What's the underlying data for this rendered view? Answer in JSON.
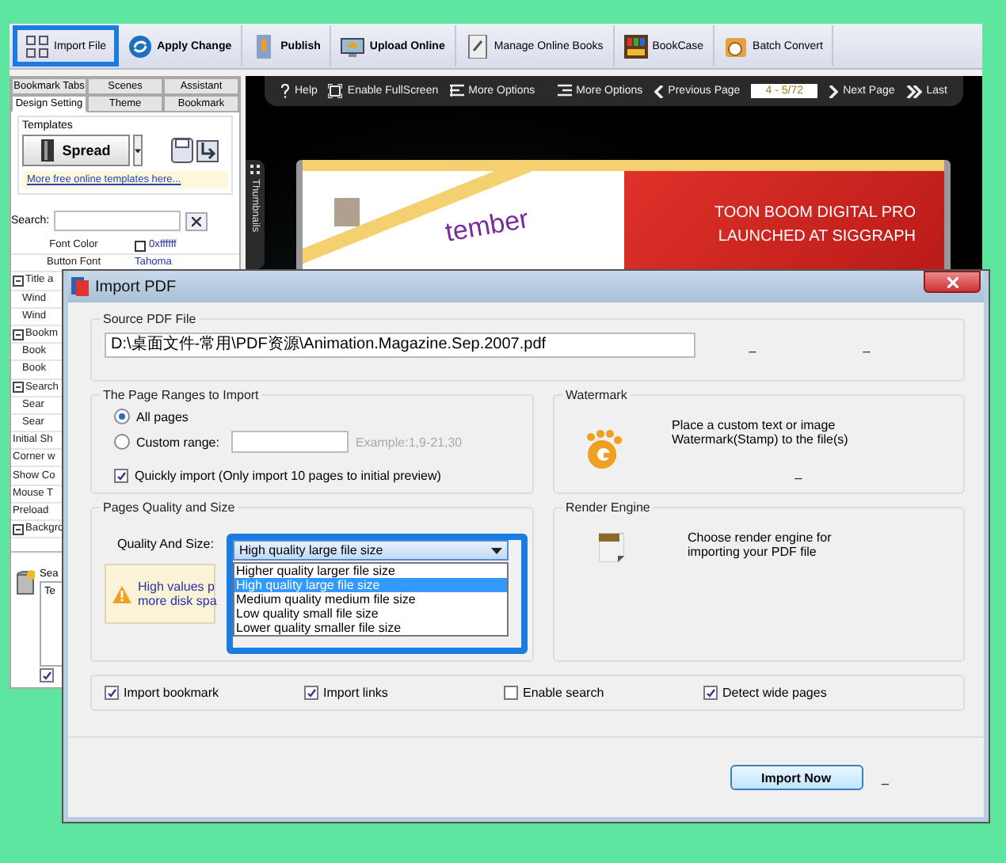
{
  "toolbar": {
    "buttons": [
      {
        "label": "Import File",
        "kind": "import",
        "highlighted": true,
        "bold": false
      },
      {
        "label": "Apply Change",
        "kind": "apply",
        "highlighted": false,
        "bold": true
      },
      {
        "label": "Publish",
        "kind": "publish",
        "highlighted": false,
        "bold": true
      },
      {
        "label": "Upload Online",
        "kind": "upload",
        "highlighted": false,
        "bold": true
      },
      {
        "label": "Manage Online Books",
        "kind": "manage",
        "highlighted": false,
        "bold": false
      },
      {
        "label": "BookCase",
        "kind": "bookcase",
        "highlighted": false,
        "bold": false
      },
      {
        "label": "Batch Convert",
        "kind": "batch",
        "highlighted": false,
        "bold": false
      }
    ]
  },
  "left_panel": {
    "tab_rows": [
      [
        {
          "label": "Bookmark Tabs",
          "selected": false
        },
        {
          "label": "Scenes",
          "selected": false
        },
        {
          "label": "Assistant",
          "selected": false
        }
      ],
      [
        {
          "label": "Design Setting",
          "selected": true
        },
        {
          "label": "Theme",
          "selected": false
        },
        {
          "label": "Bookmark",
          "selected": false
        }
      ]
    ],
    "templates": {
      "label": "Templates",
      "button": "Spread",
      "link": "More free online templates here..."
    },
    "search": {
      "label": "Search:"
    },
    "properties": [
      {
        "kind": "item",
        "label": "Font Color",
        "value": "0xffffff"
      },
      {
        "kind": "item",
        "label": "Button Font",
        "value": "Tahoma"
      },
      {
        "kind": "group",
        "label": "Title a",
        "expanded": true
      },
      {
        "kind": "sub",
        "label": "Wind"
      },
      {
        "kind": "sub",
        "label": "Wind"
      },
      {
        "kind": "group",
        "label": "Bookm",
        "expanded": true
      },
      {
        "kind": "sub",
        "label": "Book"
      },
      {
        "kind": "sub",
        "label": "Book"
      },
      {
        "kind": "group",
        "label": "Search",
        "expanded": true
      },
      {
        "kind": "sub",
        "label": "Sear"
      },
      {
        "kind": "sub",
        "label": "Sear"
      },
      {
        "kind": "item",
        "label": "Initial Sh"
      },
      {
        "kind": "item",
        "label": "Corner w"
      },
      {
        "kind": "item",
        "label": "Show Co"
      },
      {
        "kind": "item",
        "label": "Mouse T"
      },
      {
        "kind": "item",
        "label": "Preload"
      },
      {
        "kind": "group",
        "label": "Backgro",
        "expanded": true
      }
    ],
    "description": {
      "label": "Sea",
      "text": "Te",
      "checked": true
    }
  },
  "viewer": {
    "toolbar": [
      {
        "kind": "help",
        "label": "Help"
      },
      {
        "kind": "fullscreen",
        "label": "Enable FullScreen"
      },
      {
        "kind": "options",
        "label": "More Options"
      },
      {
        "kind": "spacer"
      },
      {
        "kind": "options-right",
        "label": "More Options"
      },
      {
        "kind": "prev",
        "label": "Previous Page"
      },
      {
        "kind": "page",
        "label": "4 - 5/72"
      },
      {
        "kind": "next",
        "label": "Next Page"
      },
      {
        "kind": "last",
        "label": "Last"
      }
    ],
    "side_tab": "Thumbnails",
    "book": {
      "month": "tember",
      "headline": [
        "TOON BOOM DIGITAL PRO",
        "LAUNCHED AT SIGGRAPH"
      ]
    }
  },
  "dialog": {
    "title": "Import PDF",
    "source": {
      "title": "Source PDF File",
      "value": "D:\\桌面文件-常用\\PDF资源\\Animation.Magazine.Sep.2007.pdf",
      "marks": [
        "_",
        "_"
      ]
    },
    "ranges": {
      "title": "The Page Ranges to Import",
      "options": [
        {
          "label": "All pages",
          "selected": true
        },
        {
          "label": "Custom range:",
          "selected": false
        }
      ],
      "example": "Example:1,9-21,30",
      "quick": {
        "label": "Quickly import (Only import 10 pages to  initial  preview)",
        "checked": true
      }
    },
    "watermark": {
      "title": "Watermark",
      "text": "Place a custom text or image Watermark(Stamp) to the file(s)",
      "mark": "_"
    },
    "quality": {
      "title": "Pages Quality and Size",
      "label": "Quality And Size:",
      "value": "High quality large file size",
      "highlighted": true,
      "expanded": true,
      "options": [
        {
          "label": "Higher quality larger file size",
          "selected": false
        },
        {
          "label": "High quality large file size",
          "selected": true
        },
        {
          "label": "Medium quality medium file size",
          "selected": false
        },
        {
          "label": "Low quality small file size",
          "selected": false
        },
        {
          "label": "Lower quality smaller file size",
          "selected": false
        }
      ],
      "warning_lines": [
        "High values p",
        "more disk spa"
      ]
    },
    "render": {
      "title": "Render Engine",
      "text": "Choose render engine for importing your PDF file"
    },
    "checks": [
      {
        "label": "Import bookmark",
        "checked": true
      },
      {
        "label": "Import links",
        "checked": true
      },
      {
        "label": "Enable search",
        "checked": false
      },
      {
        "label": "Detect wide pages",
        "checked": true
      }
    ],
    "button": "Import Now",
    "mark": "_"
  }
}
